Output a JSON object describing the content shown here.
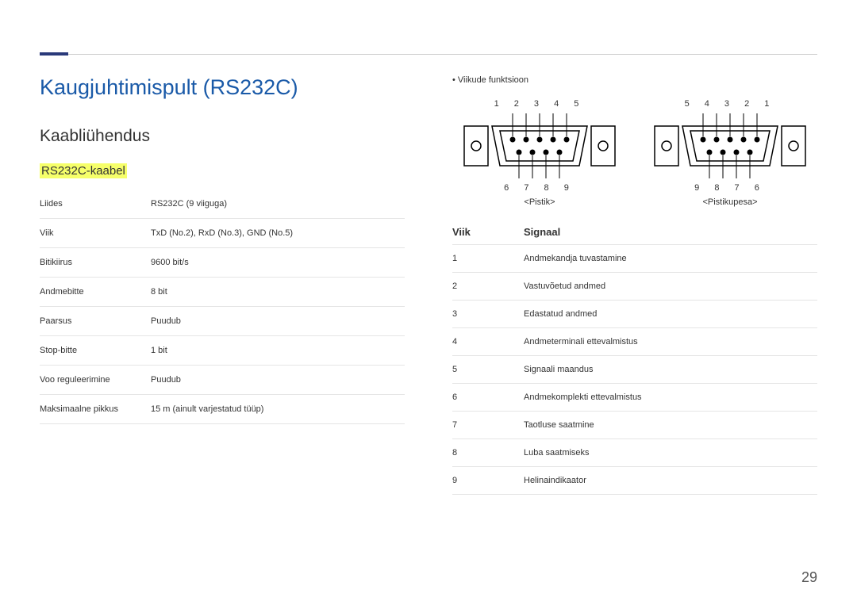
{
  "page_number": "29",
  "heading": "Kaugjuhtimispult (RS232C)",
  "subheading": "Kaabliühendus",
  "section_label": "RS232C-kaabel",
  "spec_rows": [
    {
      "label": "Liides",
      "value": "RS232C (9 viiguga)"
    },
    {
      "label": "Viik",
      "value": "TxD (No.2), RxD (No.3), GND (No.5)"
    },
    {
      "label": "Bitikiirus",
      "value": "9600 bit/s"
    },
    {
      "label": "Andmebitte",
      "value": "8 bit"
    },
    {
      "label": "Paarsus",
      "value": "Puudub"
    },
    {
      "label": "Stop-bitte",
      "value": "1 bit"
    },
    {
      "label": "Voo reguleerimine",
      "value": "Puudub"
    },
    {
      "label": "Maksimaalne pikkus",
      "value": "15 m (ainult varjestatud tüüp)"
    }
  ],
  "right_bullet": "Viikude funktsioon",
  "connector_left": {
    "top_pins": "1 2 3 4 5",
    "bottom_pins": "6 7 8 9",
    "label": "<Pistik>"
  },
  "connector_right": {
    "top_pins": "5 4 3 2 1",
    "bottom_pins": "9 8 7 6",
    "label": "<Pistikupesa>"
  },
  "signal_header": {
    "col1": "Viik",
    "col2": "Signaal"
  },
  "signal_rows": [
    {
      "pin": "1",
      "signal": "Andmekandja tuvastamine"
    },
    {
      "pin": "2",
      "signal": "Vastuvõetud andmed"
    },
    {
      "pin": "3",
      "signal": "Edastatud andmed"
    },
    {
      "pin": "4",
      "signal": "Andmeterminali ettevalmistus"
    },
    {
      "pin": "5",
      "signal": "Signaali maandus"
    },
    {
      "pin": "6",
      "signal": "Andmekomplekti ettevalmistus"
    },
    {
      "pin": "7",
      "signal": "Taotluse saatmine"
    },
    {
      "pin": "8",
      "signal": "Luba saatmiseks"
    },
    {
      "pin": "9",
      "signal": "Helinaindikaator"
    }
  ]
}
